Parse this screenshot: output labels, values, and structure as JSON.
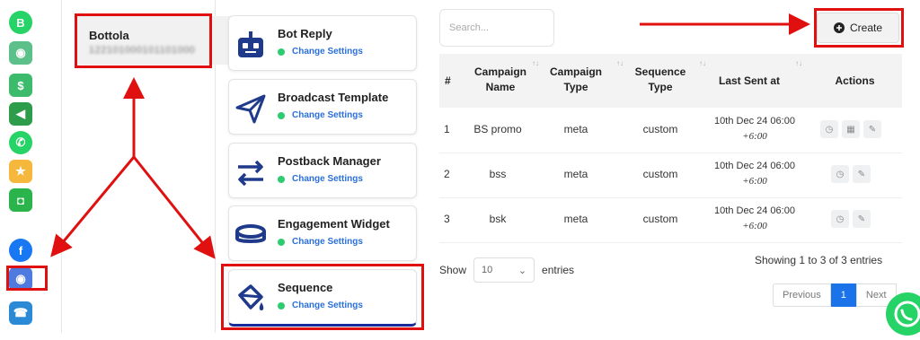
{
  "rail": {
    "icons": [
      "whatsapp-business-icon",
      "bot-icon",
      "money-icon",
      "megaphone-icon",
      "whatsapp-icon",
      "shopping-icon",
      "shopping-bag-icon",
      "facebook-icon",
      "bot-active-icon",
      "phone-book-icon"
    ]
  },
  "account": {
    "name": "Bottola",
    "id": "122101000101101000"
  },
  "cards": [
    {
      "title": "Bot Reply",
      "sub": "Change Settings",
      "icon": "robot-icon"
    },
    {
      "title": "Broadcast Template",
      "sub": "Change Settings",
      "icon": "paper-plane-icon"
    },
    {
      "title": "Postback Manager",
      "sub": "Change Settings",
      "icon": "exchange-arrows-icon"
    },
    {
      "title": "Engagement Widget",
      "sub": "Change Settings",
      "icon": "ring-icon"
    },
    {
      "title": "Sequence",
      "sub": "Change Settings",
      "icon": "paint-bucket-icon"
    }
  ],
  "search": {
    "placeholder": "Search..."
  },
  "create_label": "Create",
  "table": {
    "headers": [
      "#",
      "Campaign Name",
      "Campaign Type",
      "Sequence Type",
      "Last Sent at",
      "Actions"
    ],
    "rows": [
      {
        "n": "1",
        "name": "BS promo",
        "ctype": "meta",
        "stype": "custom",
        "sent1": "10th Dec 24 06:00",
        "sent2": "+6:00"
      },
      {
        "n": "2",
        "name": "bss",
        "ctype": "meta",
        "stype": "custom",
        "sent1": "10th Dec 24 06:00",
        "sent2": "+6:00"
      },
      {
        "n": "3",
        "name": "bsk",
        "ctype": "meta",
        "stype": "custom",
        "sent1": "10th Dec 24 06:00",
        "sent2": "+6:00"
      }
    ]
  },
  "show": {
    "prefix": "Show",
    "value": "10",
    "suffix": "entries"
  },
  "info": "Showing 1 to 3 of 3 entries",
  "pager": {
    "prev": "Previous",
    "current": "1",
    "next": "Next"
  },
  "colors": {
    "annotation": "#e01010",
    "link": "#2a6fdb",
    "status": "#2ecc71"
  }
}
